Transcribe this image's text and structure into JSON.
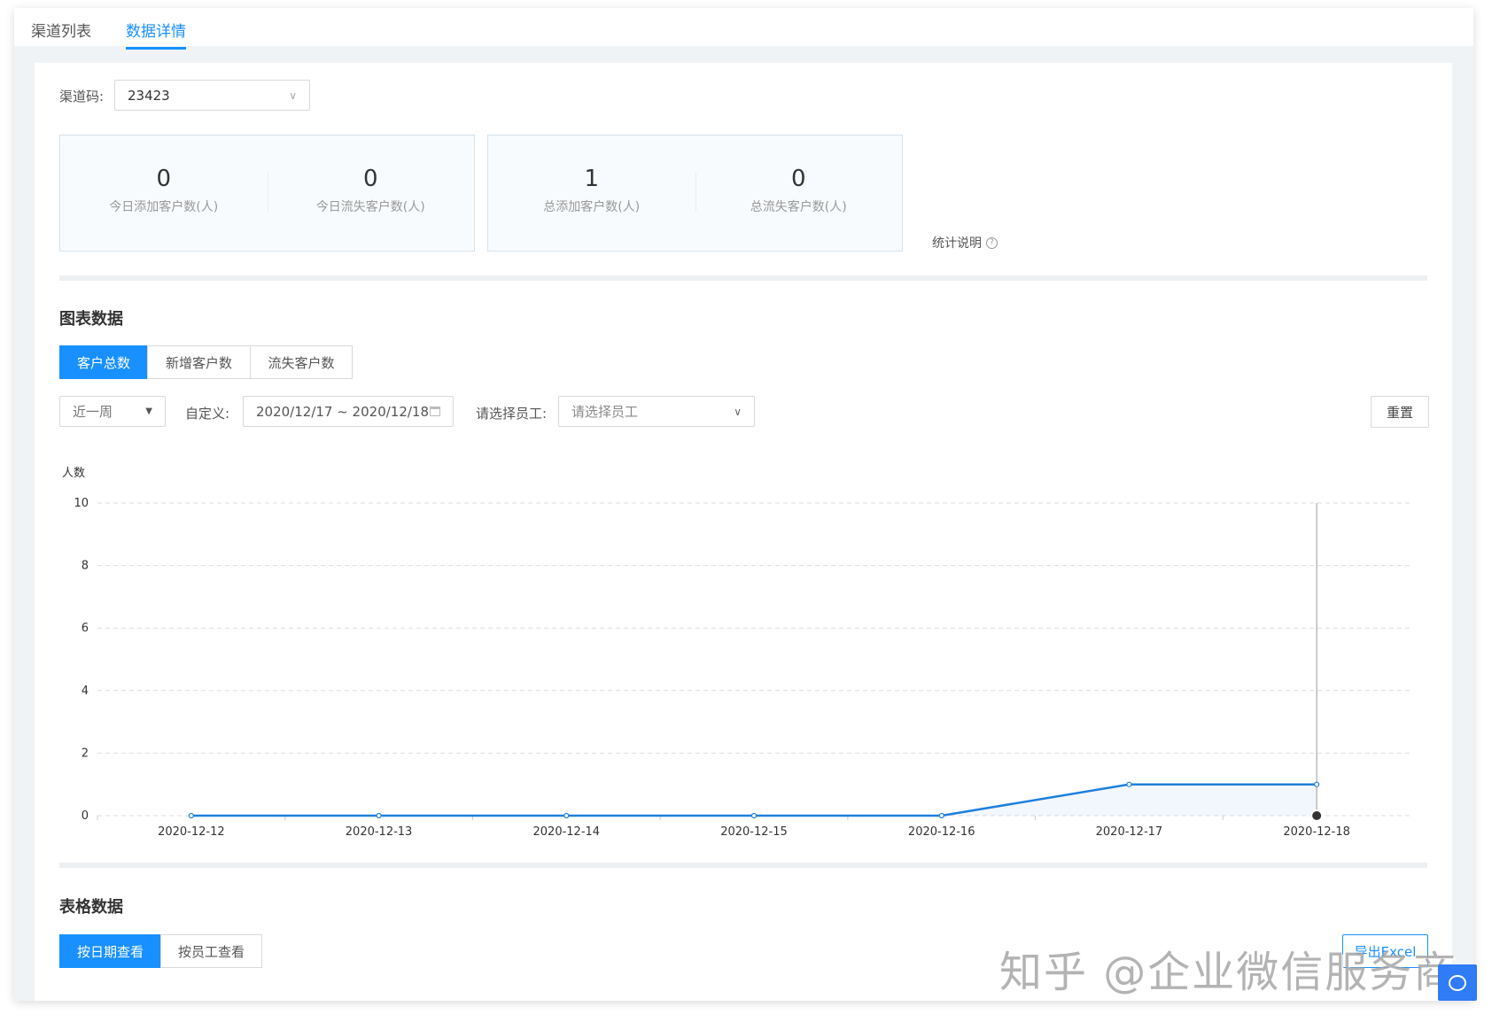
{
  "tabs": [
    {
      "label": "渠道列表"
    },
    {
      "label": "数据详情"
    }
  ],
  "channel": {
    "label": "渠道码:",
    "value": "23423"
  },
  "stats": [
    {
      "value": "0",
      "caption": "今日添加客户数(人)"
    },
    {
      "value": "0",
      "caption": "今日流失客户数(人)"
    },
    {
      "value": "1",
      "caption": "总添加客户数(人)"
    },
    {
      "value": "0",
      "caption": "总流失客户数(人)"
    }
  ],
  "stats_help": "统计说明",
  "chart_section": {
    "title": "图表数据",
    "tabs": [
      "客户总数",
      "新增客户数",
      "流失客户数"
    ],
    "period": "近一周",
    "custom_label": "自定义:",
    "date_range": "2020/12/17 ~ 2020/12/18",
    "employee_label": "请选择员工:",
    "employee_placeholder": "请选择员工",
    "reset": "重置"
  },
  "chart_data": {
    "type": "line",
    "ylabel": "人数",
    "ylim": [
      0,
      10
    ],
    "yticks": [
      0,
      2,
      4,
      6,
      8,
      10
    ],
    "grid": true,
    "categories": [
      "2020-12-12",
      "2020-12-13",
      "2020-12-14",
      "2020-12-15",
      "2020-12-16",
      "2020-12-17",
      "2020-12-18"
    ],
    "series": [
      {
        "name": "客户总数",
        "values": [
          0,
          0,
          0,
          0,
          0,
          1,
          1
        ]
      }
    ],
    "color": "#1f7fdc",
    "hover_index": 6
  },
  "table_section": {
    "title": "表格数据",
    "tabs": [
      "按日期查看",
      "按员工查看"
    ],
    "export": "导出Excel"
  },
  "watermark": "知乎 @企业微信服务商"
}
